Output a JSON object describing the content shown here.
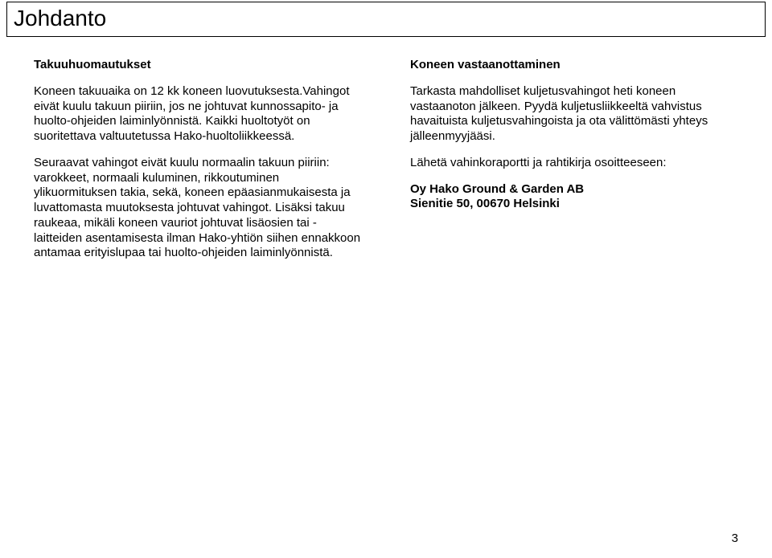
{
  "title": "Johdanto",
  "left": {
    "heading": "Takuuhuomautukset",
    "p1": "Koneen takuuaika on 12 kk koneen luovutuksesta.Vahingot eivät kuulu takuun piiriin, jos ne johtuvat kunnossapito- ja huolto-ohjeiden laiminlyönnistä. Kaikki huoltotyöt on suoritettava valtuutetussa Hako-huoltoliikkeessä.",
    "p2": "Seuraavat vahingot eivät kuulu normaalin takuun piiriin: varokkeet, normaali kuluminen, rikkoutuminen ylikuormituksen takia, sekä, koneen epäasianmukaisesta ja luvattomasta muutoksesta johtuvat vahingot. Lisäksi takuu raukeaa, mikäli koneen vauriot johtuvat lisäosien tai -laitteiden asentamisesta ilman Hako-yhtiön siihen ennakkoon antamaa erityislupaa tai huolto-ohjeiden laiminlyönnistä."
  },
  "right": {
    "heading": "Koneen vastaanottaminen",
    "p1": "Tarkasta mahdolliset kuljetusvahingot heti koneen vastaanoton jälkeen. Pyydä kuljetusliikkeeltä vahvistus havaituista kuljetusvahingoista ja ota välittömästi yhteys jälleenmyyjääsi.",
    "p2": "Lähetä vahinkoraportti ja rahtikirja osoitteeseen:",
    "addr1": "Oy Hako Ground & Garden AB",
    "addr2": "Sienitie 50, 00670 Helsinki"
  },
  "pageNumber": "3"
}
